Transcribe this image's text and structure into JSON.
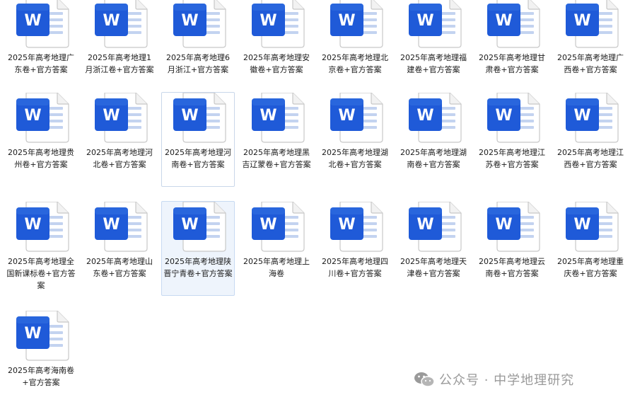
{
  "files": [
    {
      "name": "2025年高考地理广东卷+官方答案",
      "icon": "word-document-icon"
    },
    {
      "name": "2025年高考地理1月浙江卷+官方答案",
      "icon": "word-document-icon"
    },
    {
      "name": "2025年高考地理6月浙江+官方答案",
      "icon": "word-document-icon"
    },
    {
      "name": "2025年高考地理安徽卷+官方答案",
      "icon": "word-document-icon"
    },
    {
      "name": "2025年高考地理北京卷+官方答案",
      "icon": "word-document-icon"
    },
    {
      "name": "2025年高考地理福建卷+官方答案",
      "icon": "word-document-icon"
    },
    {
      "name": "2025年高考地理甘肃卷+官方答案",
      "icon": "word-document-icon"
    },
    {
      "name": "2025年高考地理广西卷+官方答案",
      "icon": "word-document-icon"
    },
    {
      "name": "2025年高考地理贵州卷+官方答案",
      "icon": "word-document-icon"
    },
    {
      "name": "2025年高考地理河北卷+官方答案",
      "icon": "word-document-icon"
    },
    {
      "name": "2025年高考地理河南卷+官方答案",
      "icon": "word-document-icon"
    },
    {
      "name": "2025年高考地理黑吉辽蒙卷+官方答案",
      "icon": "word-document-icon"
    },
    {
      "name": "2025年高考地理湖北卷+官方答案",
      "icon": "word-document-icon"
    },
    {
      "name": "2025年高考地理湖南卷+官方答案",
      "icon": "word-document-icon"
    },
    {
      "name": "2025年高考地理江苏卷+官方答案",
      "icon": "word-document-icon"
    },
    {
      "name": "2025年高考地理江西卷+官方答案",
      "icon": "word-document-icon"
    },
    {
      "name": "2025年高考地理全国新课标卷+官方答案",
      "icon": "word-document-icon"
    },
    {
      "name": "2025年高考地理山东卷+官方答案",
      "icon": "word-document-icon"
    },
    {
      "name": "2025年高考地理陕晋宁青卷+官方答案",
      "icon": "word-document-icon"
    },
    {
      "name": "2025年高考地理上海卷",
      "icon": "word-document-icon"
    },
    {
      "name": "2025年高考地理四川卷+官方答案",
      "icon": "word-document-icon"
    },
    {
      "name": "2025年高考地理天津卷+官方答案",
      "icon": "word-document-icon"
    },
    {
      "name": "2025年高考地理云南卷+官方答案",
      "icon": "word-document-icon"
    },
    {
      "name": "2025年高考地理重庆卷+官方答案",
      "icon": "word-document-icon"
    },
    {
      "name": "2025年高考海南卷+官方答案",
      "icon": "word-document-icon"
    }
  ],
  "focused_file_index": 10,
  "selected_file_index": 18,
  "watermark": {
    "text": "公众号 · 中学地理研究",
    "icon": "wechat-icon"
  },
  "colors": {
    "word_blue": "#1f5ad8",
    "word_blue_light": "#3c7fe8",
    "word_page_lines": "#c3d3f0",
    "label_text": "#1a1a1a",
    "watermark": "#9a9a9a"
  }
}
